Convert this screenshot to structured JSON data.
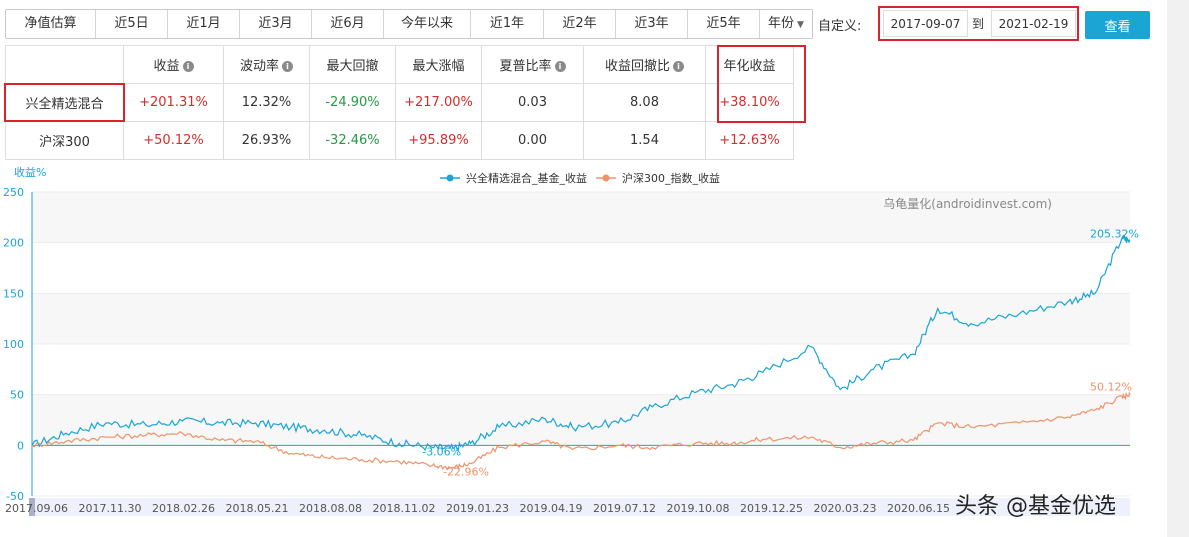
{
  "periods": [
    "净值估算",
    "近5日",
    "近1月",
    "近3月",
    "近6月",
    "今年以来",
    "近1年",
    "近2年",
    "近3年",
    "近5年",
    "年份"
  ],
  "custom": {
    "label": "自定义:",
    "start_date": "2017-09-07",
    "to_label": "到",
    "end_date": "2021-02-19",
    "query_label": "查看"
  },
  "stats": {
    "headers": [
      "收益",
      "波动率",
      "最大回撤",
      "最大涨幅",
      "夏普比率",
      "收益回撤比",
      "年化收益"
    ],
    "rows": [
      {
        "name": "兴全精选混合",
        "values": [
          "+201.31%",
          "12.32%",
          "-24.90%",
          "+217.00%",
          "0.03",
          "8.08",
          "+38.10%"
        ]
      },
      {
        "name": "沪深300",
        "values": [
          "+50.12%",
          "26.93%",
          "-32.46%",
          "+95.89%",
          "0.00",
          "1.54",
          "+12.63%"
        ]
      }
    ]
  },
  "colors": {
    "fund": "#1aa5d4",
    "index": "#f0926a",
    "positive": "#d62c2c",
    "negative": "#239a43",
    "highlight": "#d9242d"
  },
  "chart_data": {
    "type": "line",
    "ylabel": "收益%",
    "ylim": [
      -50,
      250
    ],
    "yticks": [
      -50,
      0,
      50,
      100,
      150,
      200,
      250
    ],
    "x_ticks": [
      "2017.09.06",
      "2017.11.30",
      "2018.02.26",
      "2018.05.21",
      "2018.08.08",
      "2018.11.02",
      "2019.01.23",
      "2019.04.19",
      "2019.07.12",
      "2019.10.08",
      "2019.12.25",
      "2020.03.23",
      "2020.06.15"
    ],
    "source_note": "乌龟量化(androidinvest.com)",
    "series": [
      {
        "name": "兴全精选混合_基金_收益",
        "x": [
          "2017.09.06",
          "2017.10.15",
          "2017.11.30",
          "2018.01.15",
          "2018.02.26",
          "2018.04.10",
          "2018.05.21",
          "2018.07.01",
          "2018.08.08",
          "2018.09.20",
          "2018.11.02",
          "2018.12.10",
          "2019.01.03",
          "2019.01.23",
          "2019.02.25",
          "2019.04.19",
          "2019.05.20",
          "2019.07.12",
          "2019.08.20",
          "2019.10.08",
          "2019.11.20",
          "2019.12.25",
          "2020.02.19",
          "2020.03.23",
          "2020.04.30",
          "2020.06.15",
          "2020.07.13",
          "2020.08.20",
          "2020.10.15",
          "2020.12.10",
          "2021.01.10",
          "2021.02.10",
          "2021.02.19"
        ],
        "values": [
          0,
          12,
          22,
          20,
          24,
          22,
          22,
          18,
          15,
          10,
          2,
          -2,
          -3,
          2,
          18,
          26,
          18,
          22,
          38,
          52,
          60,
          72,
          97,
          55,
          75,
          90,
          135,
          120,
          130,
          142,
          150,
          205,
          201.31
        ],
        "last_label": "205.32%"
      },
      {
        "name": "沪深300_指数_收益",
        "x": [
          "2017.09.06",
          "2017.10.15",
          "2017.11.30",
          "2018.01.15",
          "2018.02.26",
          "2018.04.10",
          "2018.05.21",
          "2018.07.01",
          "2018.08.08",
          "2018.09.20",
          "2018.11.02",
          "2018.12.10",
          "2019.01.03",
          "2019.01.23",
          "2019.02.25",
          "2019.04.19",
          "2019.05.20",
          "2019.07.12",
          "2019.08.20",
          "2019.10.08",
          "2019.11.20",
          "2019.12.25",
          "2020.02.19",
          "2020.03.23",
          "2020.04.30",
          "2020.06.15",
          "2020.07.13",
          "2020.08.20",
          "2020.10.15",
          "2020.12.10",
          "2021.01.10",
          "2021.02.10",
          "2021.02.19"
        ],
        "values": [
          0,
          4,
          8,
          10,
          12,
          5,
          4,
          -8,
          -12,
          -14,
          -16,
          -20,
          -22,
          -18,
          -2,
          4,
          -4,
          0,
          -2,
          2,
          2,
          6,
          8,
          -2,
          2,
          5,
          22,
          18,
          22,
          28,
          35,
          48,
          50.12
        ],
        "last_label": "50.12%"
      }
    ],
    "annotations": [
      {
        "series": 0,
        "x": "2018.12.10",
        "label": "-3.06%"
      },
      {
        "series": 1,
        "x": "2019.01.03",
        "label": "-22.96%"
      }
    ]
  },
  "footer": "头条 @基金优选"
}
